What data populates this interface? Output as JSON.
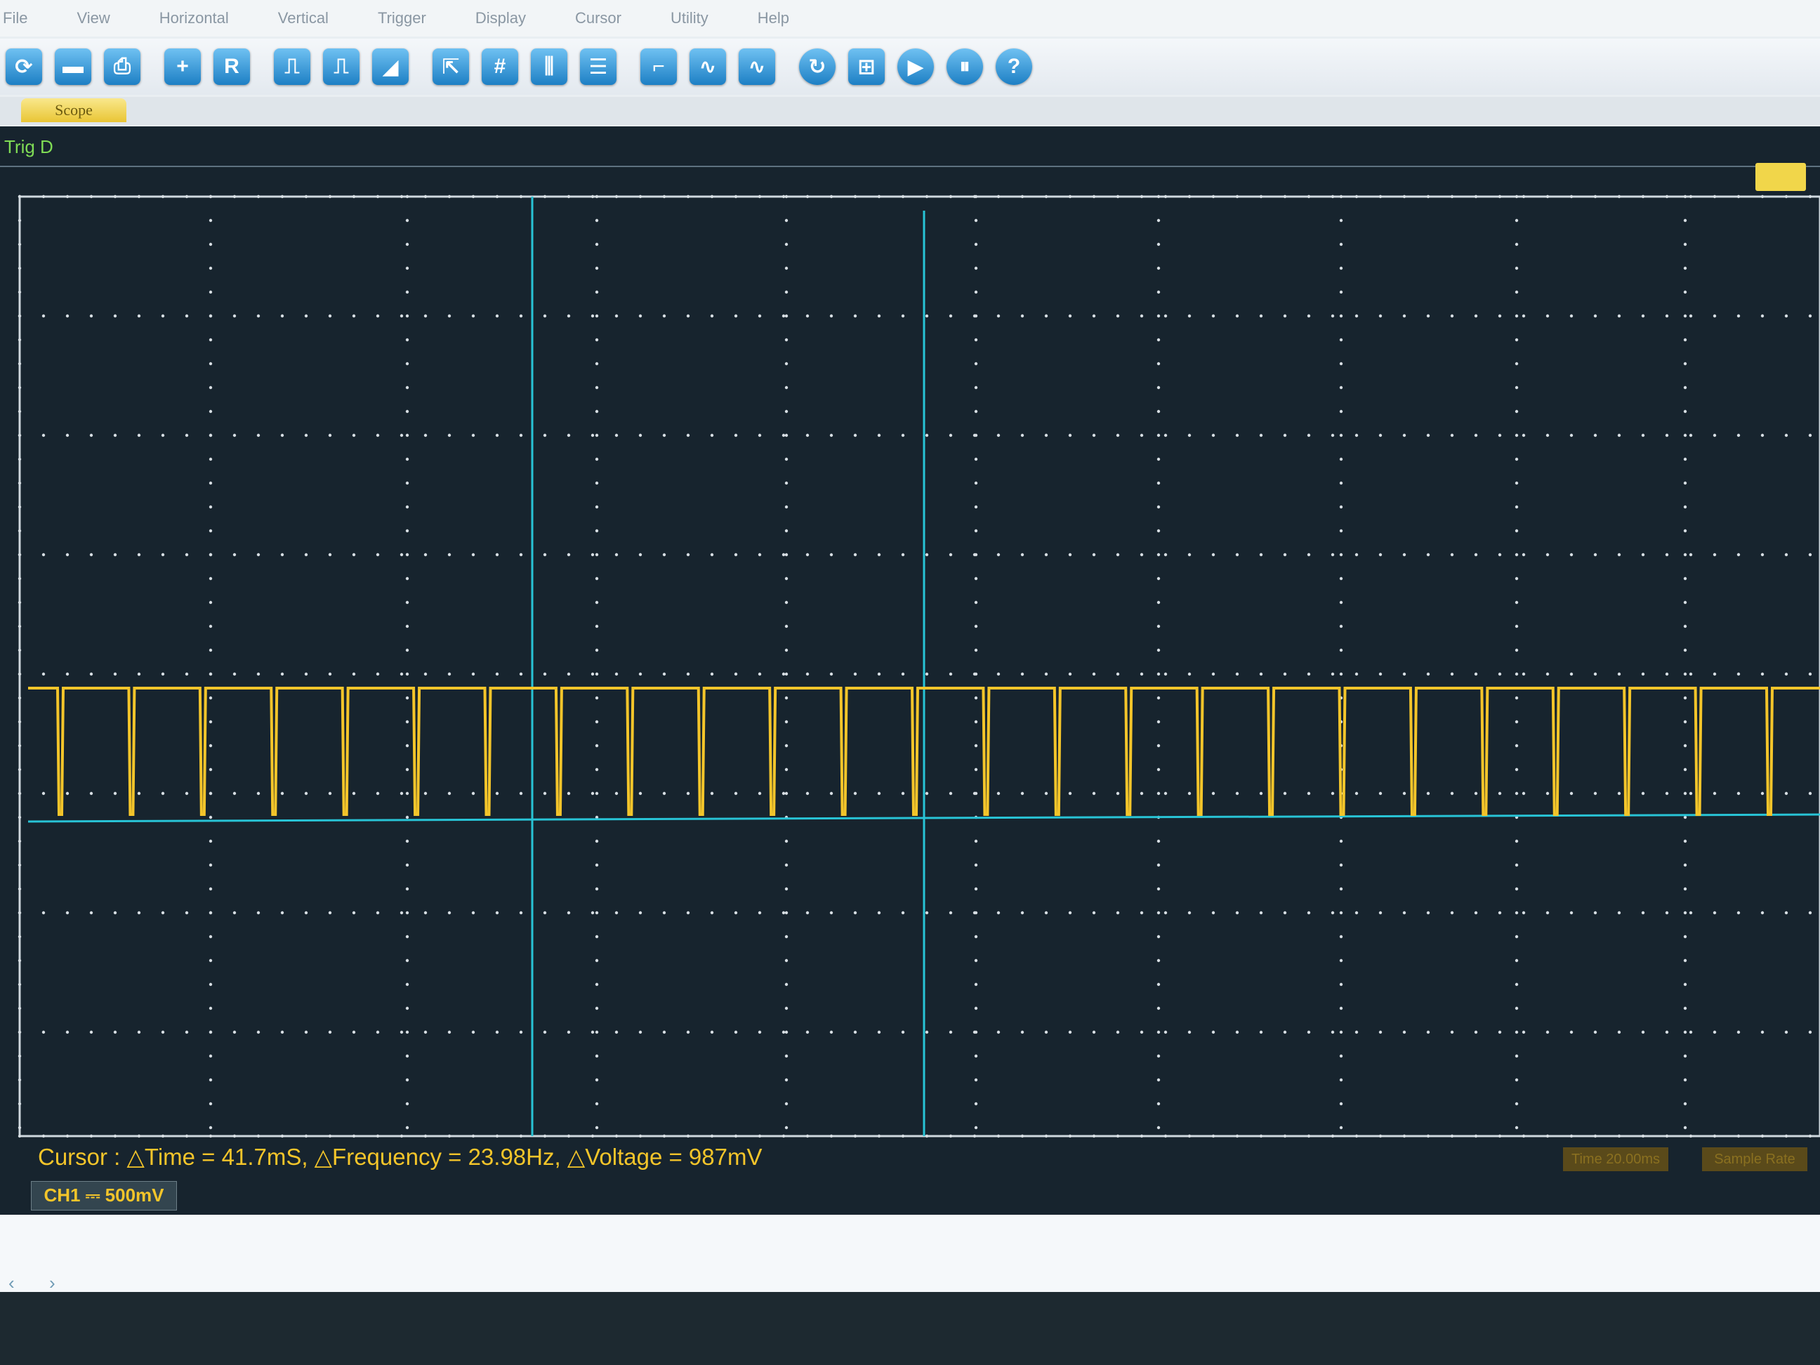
{
  "menu": {
    "items": [
      "File",
      "View",
      "Horizontal",
      "Vertical",
      "Trigger",
      "Display",
      "Cursor",
      "Utility",
      "Help"
    ]
  },
  "toolbar": {
    "buttons": [
      {
        "glyph": "⟳",
        "icon": "run-icon"
      },
      {
        "glyph": "▬",
        "icon": "save-icon"
      },
      {
        "glyph": "⎙",
        "icon": "print-icon"
      },
      {
        "glyph": "+",
        "icon": "zoom-icon"
      },
      {
        "glyph": "R",
        "icon": "reference-icon"
      },
      {
        "glyph": "⎍",
        "icon": "pulse-icon"
      },
      {
        "glyph": "⎍",
        "icon": "pulse-alt-icon"
      },
      {
        "glyph": "◢",
        "icon": "ramp-icon"
      },
      {
        "glyph": "⇱",
        "icon": "cursor-select-icon"
      },
      {
        "glyph": "#",
        "icon": "grid-icon"
      },
      {
        "glyph": "⫼",
        "icon": "cursor-vertical-icon"
      },
      {
        "glyph": "☰",
        "icon": "cursor-horizontal-icon"
      },
      {
        "glyph": "⌐",
        "icon": "step-icon"
      },
      {
        "glyph": "∿",
        "icon": "sine-icon"
      },
      {
        "glyph": "∿",
        "icon": "sine-alt-icon"
      },
      {
        "glyph": "↻",
        "icon": "auto-icon"
      },
      {
        "glyph": "⊞",
        "icon": "measure-icon"
      },
      {
        "glyph": "▶",
        "icon": "play-icon"
      },
      {
        "glyph": "⏸",
        "icon": "pause-icon"
      },
      {
        "glyph": "?",
        "icon": "help-icon"
      }
    ]
  },
  "tab": {
    "label": "Scope"
  },
  "panel": {
    "trigger_label": "Trig D",
    "status_text": "Cursor : △Time = 41.7mS, △Frequency = 23.98Hz, △Voltage = 987mV",
    "channel_label": "CH1 ⎓ 500mV",
    "right_status_1": "Time 20.00ms",
    "right_status_2": "Sample Rate"
  },
  "colors": {
    "background": "#17242e",
    "trace": "#f4c52a",
    "cursor": "#28c4d6",
    "grid_dot": "#d6dde2",
    "trigger": "#7fdc55"
  },
  "waveform": {
    "channel": "CH1",
    "pulse_count": 25,
    "high_level_div": 0.55,
    "low_level_div": -0.55
  }
}
